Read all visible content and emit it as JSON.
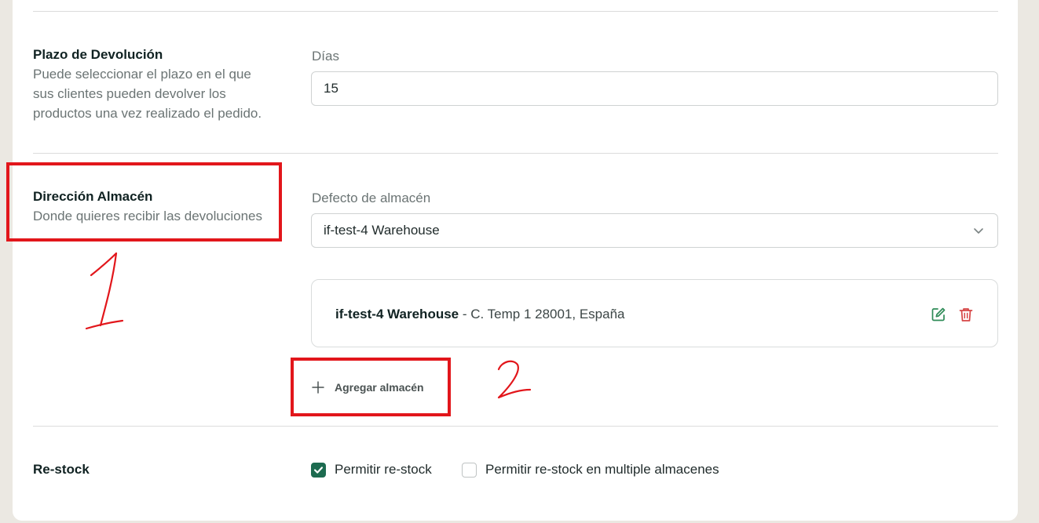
{
  "return_window": {
    "title": "Plazo de Devolución",
    "description_lines": [
      "Puede seleccionar el plazo en el que",
      "sus clientes pueden devolver los",
      "productos una vez realizado el pedido."
    ],
    "days_label": "Días",
    "days_value": "15"
  },
  "warehouse_address": {
    "title": "Dirección Almacén",
    "description": "Donde quieres recibir las devoluciones",
    "default_label": "Defecto de almacén",
    "default_selected": "if-test-4 Warehouse",
    "warehouse_card": {
      "name": "if-test-4 Warehouse",
      "address": " - C. Temp 1 28001, España"
    },
    "add_button_label": "Agregar almacén"
  },
  "restock": {
    "title": "Re-stock",
    "allow_restock_label": "Permitir re-stock",
    "allow_restock_checked": true,
    "allow_multiple_label": "Permitir re-stock en multiple almacenes",
    "allow_multiple_checked": false
  },
  "annotations": {
    "mark_1": "1",
    "mark_2": "2",
    "color": "#e2161b"
  },
  "colors": {
    "accent": "#1d6b50",
    "danger": "#d64545",
    "edit": "#2e8b57"
  }
}
